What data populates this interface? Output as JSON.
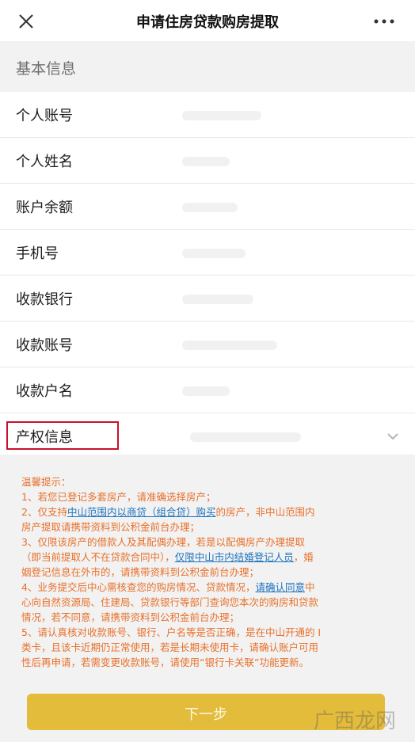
{
  "nav": {
    "title": "申请住房贷款购房提取",
    "close_icon": "close-icon",
    "more_icon": "more-dots-icon"
  },
  "section": {
    "title": "基本信息"
  },
  "rows": [
    {
      "label": "个人账号"
    },
    {
      "label": "个人姓名"
    },
    {
      "label": "账户余额"
    },
    {
      "label": "手机号"
    },
    {
      "label": "收款银行"
    },
    {
      "label": "收款账号"
    },
    {
      "label": "收款户名"
    }
  ],
  "property": {
    "label": "产权信息",
    "chevron_icon": "chevron-down-icon",
    "highlight_color": "#c8102e"
  },
  "notice": {
    "title": "温馨提示：",
    "item1": "1、若您已登记多套房产，请准确选择房产；",
    "item2_pre": "2、仅支持",
    "item2_link": "中山范围内以商贷（组合贷）购买",
    "item2_post": "的房产，非中山范围内",
    "item2_line2": "房产提取请携带资料到公积金前台办理；",
    "item3_line1": "3、仅限该房产的借款人及其配偶办理，若是以配偶房产办理提取",
    "item3_pre": "（即当前提取人不在贷款合同中），",
    "item3_link": "仅限中山市内结婚登记人员",
    "item3_post": "，婚",
    "item3_line3": "姻登记信息在外市的，请携带资料到公积金前台办理；",
    "item4_pre": "4、业务提交后中心需核查您的购房情况、贷款情况，",
    "item4_link": "请确认同意",
    "item4_post": "中",
    "item4_line2": "心向自然资源局、住建局、贷款银行等部门查询您本次的购房和贷款",
    "item4_line3": "情况，若不同意，请携带资料到公积金前台办理；",
    "item5_line1": "5、请认真核对收款账号、银行、户名等是否正确，是在中山开通的 I",
    "item5_line2": "类卡，且该卡近期仍正常使用，若是长期未使用卡，请确认账户可用",
    "item5_line3": "性后再申请，若需变更收款账号，请使用“银行卡关联”功能更新。",
    "text_color": "#e8702a",
    "link_color": "#1e73be"
  },
  "button": {
    "label": "下一步",
    "color": "#e3bc3c"
  },
  "watermark": {
    "text": "广西龙网"
  }
}
